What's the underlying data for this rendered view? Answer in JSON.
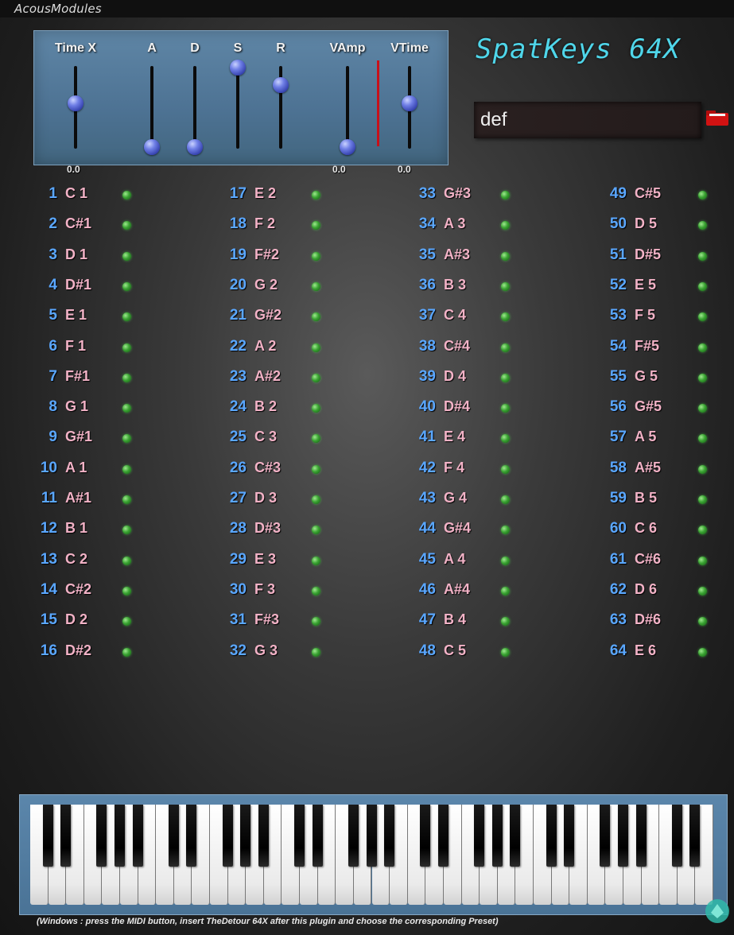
{
  "app": {
    "brand": "AcousModules",
    "title": "SpatKeys 64X"
  },
  "envelope": {
    "sliders": [
      {
        "label": "Time X",
        "level": 0.55
      },
      {
        "label": "A",
        "level": 0.0
      },
      {
        "label": "D",
        "level": 0.0
      },
      {
        "label": "S",
        "level": 1.0
      },
      {
        "label": "R",
        "level": 0.78
      },
      {
        "label": "VAmp",
        "level": 0.0
      },
      {
        "label": "VTime",
        "level": 0.55
      }
    ],
    "values": {
      "time_x": "0.0",
      "vamp": "0.0",
      "vtime": "0.0"
    },
    "meter_color": "#c8101a"
  },
  "preset": {
    "name": "def",
    "folder_icon": "folder-icon",
    "folder_color": "#e01010"
  },
  "keys_list": [
    [
      [
        "1",
        "C 1"
      ],
      [
        "2",
        "C#1"
      ],
      [
        "3",
        "D 1"
      ],
      [
        "4",
        "D#1"
      ],
      [
        "5",
        "E 1"
      ],
      [
        "6",
        "F 1"
      ],
      [
        "7",
        "F#1"
      ],
      [
        "8",
        "G 1"
      ],
      [
        "9",
        "G#1"
      ],
      [
        "10",
        "A 1"
      ],
      [
        "11",
        "A#1"
      ],
      [
        "12",
        "B 1"
      ],
      [
        "13",
        "C 2"
      ],
      [
        "14",
        "C#2"
      ],
      [
        "15",
        "D 2"
      ],
      [
        "16",
        "D#2"
      ]
    ],
    [
      [
        "17",
        "E 2"
      ],
      [
        "18",
        "F 2"
      ],
      [
        "19",
        "F#2"
      ],
      [
        "20",
        "G 2"
      ],
      [
        "21",
        "G#2"
      ],
      [
        "22",
        "A 2"
      ],
      [
        "23",
        "A#2"
      ],
      [
        "24",
        "B 2"
      ],
      [
        "25",
        "C 3"
      ],
      [
        "26",
        "C#3"
      ],
      [
        "27",
        "D 3"
      ],
      [
        "28",
        "D#3"
      ],
      [
        "29",
        "E 3"
      ],
      [
        "30",
        "F 3"
      ],
      [
        "31",
        "F#3"
      ],
      [
        "32",
        "G 3"
      ]
    ],
    [
      [
        "33",
        "G#3"
      ],
      [
        "34",
        "A 3"
      ],
      [
        "35",
        "A#3"
      ],
      [
        "36",
        "B 3"
      ],
      [
        "37",
        "C 4"
      ],
      [
        "38",
        "C#4"
      ],
      [
        "39",
        "D 4"
      ],
      [
        "40",
        "D#4"
      ],
      [
        "41",
        "E 4"
      ],
      [
        "42",
        "F 4"
      ],
      [
        "43",
        "G 4"
      ],
      [
        "44",
        "G#4"
      ],
      [
        "45",
        "A 4"
      ],
      [
        "46",
        "A#4"
      ],
      [
        "47",
        "B 4"
      ],
      [
        "48",
        "C 5"
      ]
    ],
    [
      [
        "49",
        "C#5"
      ],
      [
        "50",
        "D 5"
      ],
      [
        "51",
        "D#5"
      ],
      [
        "52",
        "E 5"
      ],
      [
        "53",
        "F 5"
      ],
      [
        "54",
        "F#5"
      ],
      [
        "55",
        "G 5"
      ],
      [
        "56",
        "G#5"
      ],
      [
        "57",
        "A 5"
      ],
      [
        "58",
        "A#5"
      ],
      [
        "59",
        "B 5"
      ],
      [
        "60",
        "C 6"
      ],
      [
        "61",
        "C#6"
      ],
      [
        "62",
        "D 6"
      ],
      [
        "63",
        "D#6"
      ],
      [
        "64",
        "E 6"
      ]
    ]
  ],
  "colors": {
    "number": "#5aa7ff",
    "note": "#f2b2c6",
    "led": "#3aa332",
    "title": "#4fd6ea"
  },
  "footer": {
    "text": "(Windows : press the MIDI button, insert TheDetour 64X after this plugin and choose the corresponding Preset)"
  }
}
